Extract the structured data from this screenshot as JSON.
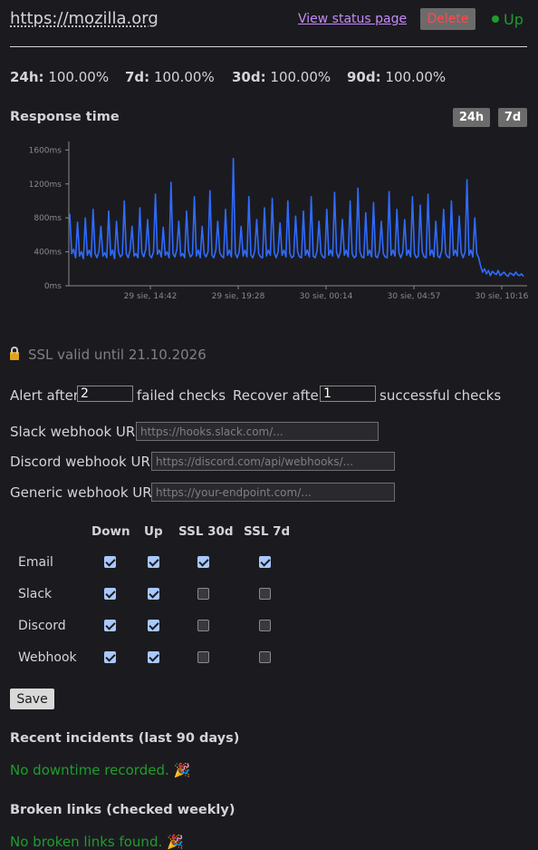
{
  "header": {
    "site_url": "https://mozilla.org",
    "status_page_link": "View status page",
    "delete_label": "Delete",
    "status": "Up"
  },
  "uptime": [
    {
      "label": "24h:",
      "value": "100.00%"
    },
    {
      "label": "7d:",
      "value": "100.00%"
    },
    {
      "label": "30d:",
      "value": "100.00%"
    },
    {
      "label": "90d:",
      "value": "100.00%"
    }
  ],
  "response_time": {
    "title": "Response time",
    "ranges": [
      "24h",
      "7d"
    ]
  },
  "chart_data": {
    "type": "line",
    "title": "Response time",
    "xlabel": "",
    "ylabel": "",
    "y_ticks": [
      "0ms",
      "400ms",
      "800ms",
      "1200ms",
      "1600ms"
    ],
    "ylim": [
      0,
      1700
    ],
    "x_ticks": [
      "29 sie, 14:42",
      "29 sie, 19:28",
      "30 sie, 00:14",
      "30 sie, 04:57",
      "30 sie, 10:16"
    ],
    "grid": false,
    "color": "#2f6bff",
    "series": [
      {
        "values": [
          850,
          380,
          430,
          330,
          750,
          350,
          400,
          320,
          800,
          360,
          420,
          340,
          900,
          380,
          330,
          410,
          700,
          350,
          390,
          330,
          880,
          360,
          420,
          320,
          760,
          400,
          340,
          370,
          1000,
          380,
          330,
          420,
          700,
          350,
          380,
          330,
          920,
          390,
          340,
          430,
          780,
          360,
          330,
          400,
          1080,
          370,
          420,
          340,
          690,
          360,
          400,
          330,
          1220,
          380,
          340,
          430,
          760,
          350,
          380,
          330,
          880,
          410,
          340,
          370,
          1050,
          350,
          420,
          330,
          700,
          380,
          340,
          400,
          1120,
          360,
          330,
          420,
          760,
          390,
          350,
          330,
          900,
          360,
          420,
          340,
          1500,
          380,
          330,
          400,
          700,
          350,
          420,
          340,
          1050,
          360,
          330,
          410,
          780,
          380,
          340,
          330,
          920,
          350,
          420,
          360,
          1030,
          390,
          330,
          400,
          740,
          360,
          420,
          340,
          1000,
          380,
          330,
          350,
          820,
          400,
          340,
          330,
          880,
          360,
          420,
          340,
          1050,
          350,
          330,
          410,
          760,
          380,
          340,
          330,
          900,
          360,
          420,
          350,
          1100,
          390,
          330,
          400,
          780,
          360,
          420,
          340,
          1000,
          380,
          330,
          350,
          1150,
          400,
          340,
          330,
          860,
          360,
          420,
          340,
          980,
          350,
          330,
          410,
          760,
          380,
          340,
          330,
          1110,
          360,
          420,
          350,
          900,
          390,
          330,
          400,
          780,
          360,
          420,
          340,
          1050,
          380,
          330,
          350,
          950,
          400,
          340,
          330,
          1080,
          360,
          420,
          340,
          760,
          350,
          330,
          410,
          900,
          380,
          340,
          330,
          1000,
          360,
          420,
          350,
          820,
          390,
          330,
          400,
          1250,
          360,
          420,
          340,
          800,
          380,
          330,
          230,
          160,
          200,
          140,
          180,
          120,
          170,
          150,
          130,
          180,
          120,
          140,
          160,
          130,
          110,
          150,
          140,
          120,
          160,
          130,
          120,
          140,
          110
        ]
      }
    ]
  },
  "ssl": {
    "text": "SSL valid until 21.10.2026"
  },
  "alerts": {
    "alert_after_label": "Alert after",
    "alert_after_value": "2",
    "failed_checks_label": "failed checks",
    "recover_after_label": "Recover after",
    "recover_after_value": "1",
    "successful_checks_label": "successful checks"
  },
  "webhooks": [
    {
      "label": "Slack webhook URL",
      "placeholder": "https://hooks.slack.com/..."
    },
    {
      "label": "Discord webhook URL",
      "placeholder": "https://discord.com/api/webhooks/..."
    },
    {
      "label": "Generic webhook URL",
      "placeholder": "https://your-endpoint.com/..."
    }
  ],
  "notifications": {
    "columns": [
      "Down",
      "Up",
      "SSL 30d",
      "SSL 7d"
    ],
    "rows": [
      {
        "label": "Email",
        "checks": [
          true,
          true,
          true,
          true
        ]
      },
      {
        "label": "Slack",
        "checks": [
          true,
          true,
          false,
          false
        ]
      },
      {
        "label": "Discord",
        "checks": [
          true,
          true,
          false,
          false
        ]
      },
      {
        "label": "Webhook",
        "checks": [
          true,
          true,
          false,
          false
        ]
      }
    ]
  },
  "save_label": "Save",
  "incidents": {
    "title": "Recent incidents (last 90 days)",
    "message": "No downtime recorded. 🎉"
  },
  "broken_links": {
    "title": "Broken links (checked weekly)",
    "message": "No broken links found. 🎉"
  }
}
